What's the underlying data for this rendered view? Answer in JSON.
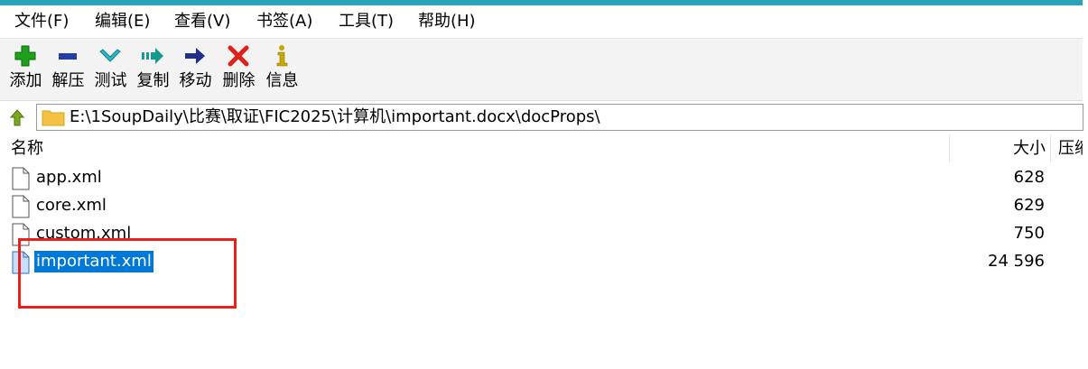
{
  "menu": [
    {
      "label": "文件(F)",
      "name": "menu-file"
    },
    {
      "label": "编辑(E)",
      "name": "menu-edit"
    },
    {
      "label": "查看(V)",
      "name": "menu-view"
    },
    {
      "label": "书签(A)",
      "name": "menu-bookmarks"
    },
    {
      "label": "工具(T)",
      "name": "menu-tools"
    },
    {
      "label": "帮助(H)",
      "name": "menu-help"
    }
  ],
  "toolbar": [
    {
      "label": "添加",
      "icon": "plus-icon",
      "color": "#1ea01e"
    },
    {
      "label": "解压",
      "icon": "minus-icon",
      "color": "#1f3fa6"
    },
    {
      "label": "测试",
      "icon": "check-icon",
      "color": "#2ab8c8"
    },
    {
      "label": "复制",
      "icon": "copy-arrow-icon",
      "color": "#169a8e"
    },
    {
      "label": "移动",
      "icon": "move-arrow-icon",
      "color": "#1f2f8a"
    },
    {
      "label": "删除",
      "icon": "delete-x-icon",
      "color": "#e0201c"
    },
    {
      "label": "信息",
      "icon": "info-icon",
      "color": "#c8a800"
    }
  ],
  "address": {
    "path": "E:\\1SoupDaily\\比赛\\取证\\FIC2025\\计算机\\important.docx\\docProps\\"
  },
  "columns": {
    "name": "名称",
    "size": "大小",
    "packed": "压缩"
  },
  "files": [
    {
      "name": "app.xml",
      "size": "628",
      "selected": false
    },
    {
      "name": "core.xml",
      "size": "629",
      "selected": false
    },
    {
      "name": "custom.xml",
      "size": "750",
      "selected": false
    },
    {
      "name": "important.xml",
      "size": "24 596",
      "selected": true
    }
  ],
  "colors": {
    "accent": "#2aa3b8",
    "selection": "#0078d7",
    "highlight_box": "#e8201c"
  }
}
